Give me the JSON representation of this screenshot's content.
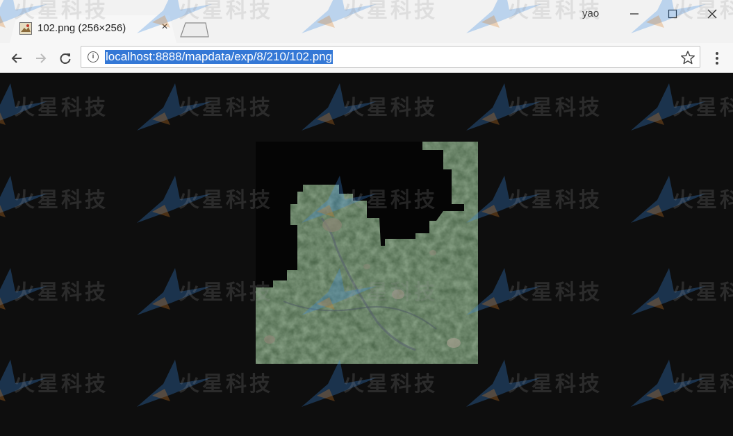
{
  "window": {
    "user_name": "yao",
    "controls": {
      "minimize": "minimize-icon",
      "maximize": "maximize-icon",
      "close": "close-icon"
    }
  },
  "tab": {
    "title": "102.png (256×256)",
    "favicon": "image-file-icon",
    "close": "×"
  },
  "toolbar": {
    "back": "back-arrow-icon",
    "forward": "forward-arrow-icon",
    "reload": "reload-icon",
    "site_info": "i",
    "url": "localhost:8888/mapdata/exp/8/210/102.png",
    "bookmark": "star-icon",
    "menu": "vertical-dots-icon"
  },
  "content": {
    "image_alt": "satellite map tile",
    "background_color": "#0e0e0e",
    "selection_color": "#3478d6"
  },
  "watermark": {
    "text": "火星科技"
  }
}
